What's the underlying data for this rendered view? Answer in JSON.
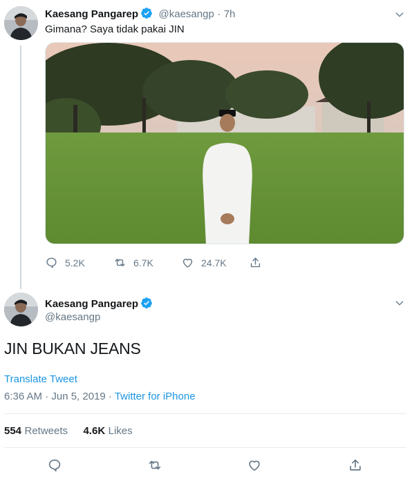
{
  "tweet1": {
    "name": "Kaesang Pangarep",
    "handle": "@kaesangp",
    "time": "7h",
    "separator": "·",
    "text": "Gimana? Saya tidak pakai JIN",
    "actions": {
      "replies": "5.2K",
      "retweets": "6.7K",
      "likes": "24.7K"
    },
    "icons": [
      "reply-icon",
      "retweet-icon",
      "like-icon",
      "share-icon",
      "verified-badge-icon",
      "chevron-down-icon"
    ]
  },
  "tweet2": {
    "name": "Kaesang Pangarep",
    "handle": "@kaesangp",
    "text": "JIN BUKAN JEANS",
    "translate": "Translate Tweet",
    "timestamp": "6:36 AM · Jun 5, 2019 · ",
    "source": "Twitter for iPhone",
    "stats": {
      "retweets_count": "554",
      "retweets_label": "Retweets",
      "likes_count": "4.6K",
      "likes_label": "Likes"
    }
  },
  "colors": {
    "accent": "#1b95e0",
    "verified": "#1da1f2",
    "muted": "#657786",
    "text": "#14171a"
  }
}
